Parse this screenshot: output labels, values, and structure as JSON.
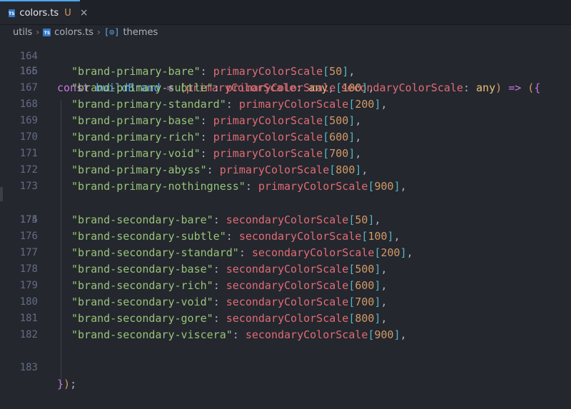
{
  "tab": {
    "filename": "colors.ts",
    "status": "U",
    "icon": "ts-file-icon",
    "close_glyph": "×"
  },
  "breadcrumb": {
    "folder": "utils",
    "file": "colors.ts",
    "symbol": "themes"
  },
  "editor": {
    "partial_line_number": "164",
    "header": {
      "number": "165",
      "keyword": "const",
      "name": "buildBrand",
      "param1": "primaryColorScale",
      "param2": "secondaryColorScale",
      "type": "any"
    },
    "primary_lines": [
      {
        "number": "166",
        "key": "\"brand-primary-bare\"",
        "obj": "primaryColorScale",
        "index": "50"
      },
      {
        "number": "167",
        "key": "\"brand-primary-subtle\"",
        "obj": "primaryColorScale",
        "index": "100"
      },
      {
        "number": "168",
        "key": "\"brand-primary-standard\"",
        "obj": "primaryColorScale",
        "index": "200"
      },
      {
        "number": "169",
        "key": "\"brand-primary-base\"",
        "obj": "primaryColorScale",
        "index": "500"
      },
      {
        "number": "170",
        "key": "\"brand-primary-rich\"",
        "obj": "primaryColorScale",
        "index": "600"
      },
      {
        "number": "171",
        "key": "\"brand-primary-void\"",
        "obj": "primaryColorScale",
        "index": "700"
      },
      {
        "number": "172",
        "key": "\"brand-primary-abyss\"",
        "obj": "primaryColorScale",
        "index": "800"
      },
      {
        "number": "173",
        "key": "\"brand-primary-nothingness\"",
        "obj": "primaryColorScale",
        "index": "900"
      }
    ],
    "blank_line_number": "174",
    "secondary_lines": [
      {
        "number": "175",
        "key": "\"brand-secondary-bare\"",
        "obj": "secondaryColorScale",
        "index": "50"
      },
      {
        "number": "176",
        "key": "\"brand-secondary-subtle\"",
        "obj": "secondaryColorScale",
        "index": "100"
      },
      {
        "number": "177",
        "key": "\"brand-secondary-standard\"",
        "obj": "secondaryColorScale",
        "index": "200"
      },
      {
        "number": "178",
        "key": "\"brand-secondary-base\"",
        "obj": "secondaryColorScale",
        "index": "500"
      },
      {
        "number": "179",
        "key": "\"brand-secondary-rich\"",
        "obj": "secondaryColorScale",
        "index": "600"
      },
      {
        "number": "180",
        "key": "\"brand-secondary-void\"",
        "obj": "secondaryColorScale",
        "index": "700"
      },
      {
        "number": "181",
        "key": "\"brand-secondary-gore\"",
        "obj": "secondaryColorScale",
        "index": "800"
      },
      {
        "number": "182",
        "key": "\"brand-secondary-viscera\"",
        "obj": "secondaryColorScale",
        "index": "900"
      }
    ],
    "closing": {
      "number": "183",
      "text": "});"
    }
  },
  "colors": {
    "background": "#24272e",
    "keyword": "#c678dd",
    "function": "#61afef",
    "string": "#98c379",
    "variable": "#e06c75",
    "number": "#d19a66",
    "type": "#e5c07b"
  }
}
